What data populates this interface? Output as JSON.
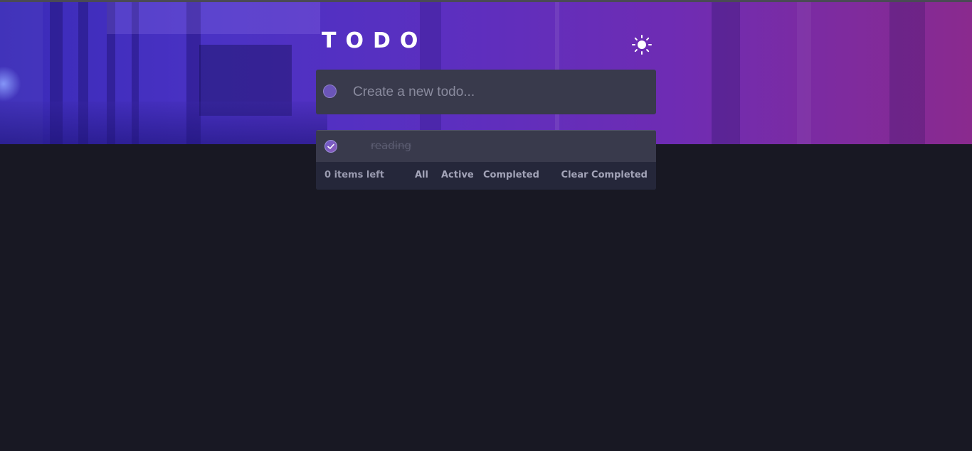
{
  "header": {
    "title": "TODO",
    "theme_icon": "sun-icon"
  },
  "new_todo": {
    "placeholder": "Create a new todo..."
  },
  "todos": [
    {
      "text": "reading",
      "completed": true
    }
  ],
  "footer": {
    "items_left": "0 items left",
    "filters": [
      "All",
      "Active",
      "Completed"
    ],
    "clear_label": "Clear Completed"
  },
  "colors": {
    "background": "#181823",
    "card": "#393a4c",
    "footer": "#25273a",
    "accent_start": "#3a2bb8",
    "accent_end": "#8a2a8e"
  }
}
